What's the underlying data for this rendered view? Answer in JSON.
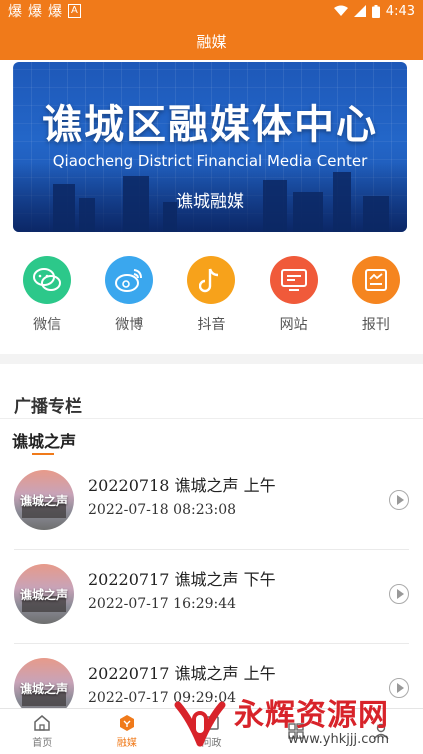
{
  "status_bar": {
    "time": "4:43",
    "left_icons": [
      "爆",
      "爆",
      "爆",
      "A"
    ]
  },
  "header": {
    "title": "融媒"
  },
  "banner": {
    "title": "谯城区融媒体中心",
    "subtitle": "Qiaocheng District Financial Media Center",
    "caption": "谯城融媒"
  },
  "shortcuts": [
    {
      "label": "微信",
      "icon": "wechat-icon",
      "color": "#2cc88a"
    },
    {
      "label": "微博",
      "icon": "weibo-icon",
      "color": "#3aa7ee"
    },
    {
      "label": "抖音",
      "icon": "douyin-icon",
      "color": "#f7a21b"
    },
    {
      "label": "网站",
      "icon": "website-icon",
      "color": "#f05a3a"
    },
    {
      "label": "报刊",
      "icon": "newspaper-icon",
      "color": "#f5851f"
    }
  ],
  "section": {
    "title": "广播专栏"
  },
  "column": {
    "tab": "谯城之声"
  },
  "items": [
    {
      "thumb_text": "谯城之声",
      "title": "20220718 谯城之声 上午",
      "date": "2022-07-18 08:23:08"
    },
    {
      "thumb_text": "谯城之声",
      "title": "20220717 谯城之声 下午",
      "date": "2022-07-17 16:29:44"
    },
    {
      "thumb_text": "谯城之声",
      "title": "20220717 谯城之声 上午",
      "date": "2022-07-17 09:29:04"
    }
  ],
  "bottom_nav": [
    {
      "label": "首页",
      "icon": "home-icon",
      "active": false
    },
    {
      "label": "融媒",
      "icon": "media-icon",
      "active": true
    },
    {
      "label": "问政",
      "icon": "politics-icon",
      "active": false
    },
    {
      "label": "",
      "icon": "service-icon",
      "active": false
    },
    {
      "label": "",
      "icon": "profile-icon",
      "active": false
    }
  ],
  "watermark": {
    "text": "永辉资源网",
    "url": "www.yhkjjj.com"
  },
  "colors": {
    "accent": "#f07a1a",
    "banner": "#2366c8",
    "watermark": "#d8232a"
  }
}
